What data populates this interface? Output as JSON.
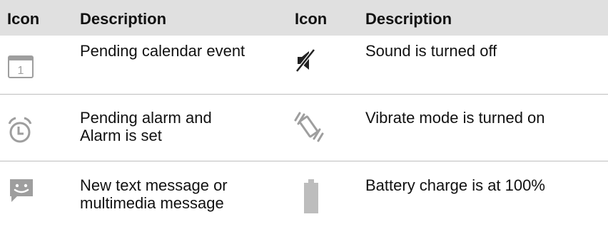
{
  "table": {
    "headers": [
      "Icon",
      "Description",
      "Icon",
      "Description"
    ],
    "rows": [
      {
        "left_icon": "calendar-icon",
        "left_icon_text": "1",
        "left_lines": [
          "Pending calendar event"
        ],
        "right_icon": "sound-off-icon",
        "right_lines": [
          "Sound is turned off"
        ]
      },
      {
        "left_icon": "alarm-clock-icon",
        "left_lines": [
          "Pending alarm and",
          "Alarm is set"
        ],
        "right_icon": "vibrate-icon",
        "right_lines": [
          "Vibrate mode is turned on"
        ]
      },
      {
        "left_icon": "text-message-icon",
        "left_lines": [
          "New text message or",
          "multimedia message"
        ],
        "right_icon": "battery-full-icon",
        "right_lines": [
          "Battery charge is at 100%"
        ]
      }
    ]
  },
  "colors": {
    "header_bg": "#e0e0e0",
    "icon_gray": "#9e9e9e",
    "divider": "#bdbdbd"
  }
}
